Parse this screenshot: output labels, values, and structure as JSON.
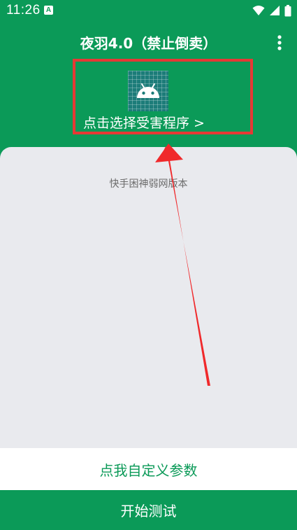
{
  "status_bar": {
    "time": "11:26",
    "notification_glyph": "A",
    "icons": [
      "wifi-icon",
      "signal-icon",
      "battery-icon"
    ]
  },
  "toolbar": {
    "title": "夜羽4.0（禁止倒卖）",
    "more_icon": "more-vert-icon"
  },
  "app_selector": {
    "icon": "android-icon",
    "label": "点击选择受害程序 >"
  },
  "panel": {
    "text": "快手困神弱网版本"
  },
  "buttons": {
    "custom_params": "点我自定义参数",
    "start_test": "开始测试"
  },
  "colors": {
    "primary": "#0b9a58",
    "panel_background": "#e9eaee",
    "highlight": "#e53935",
    "app_icon_background": "#1c7c79"
  }
}
